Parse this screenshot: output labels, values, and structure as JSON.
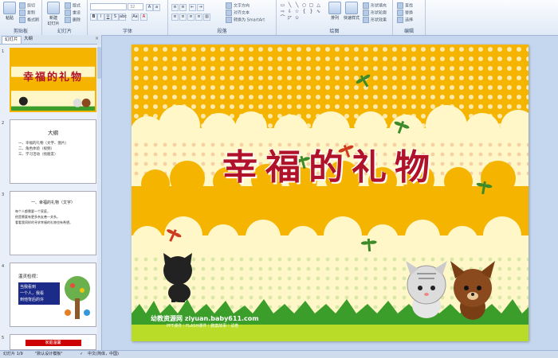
{
  "ribbon": {
    "clipboard": {
      "paste": "粘贴",
      "cut": "剪切",
      "copy": "复制",
      "format_painter": "格式刷",
      "label": "剪贴板"
    },
    "slides": {
      "new_slide": "新建\n幻灯片",
      "layout": "版式",
      "reset": "重设",
      "delete": "删除",
      "label": "幻灯片"
    },
    "font": {
      "size": "32",
      "label": "字体"
    },
    "paragraph": {
      "text_direction": "文字方向",
      "align_text": "对齐文本",
      "smartart": "转换为 SmartArt",
      "label": "段落"
    },
    "drawing": {
      "arrange": "排列",
      "quick_styles": "快速样式",
      "shape_fill": "形状填充",
      "shape_outline": "形状轮廓",
      "shape_effects": "形状效果",
      "label": "绘图"
    },
    "editing": {
      "find": "查找",
      "replace": "替换",
      "select": "选择",
      "label": "编辑"
    }
  },
  "left_pane": {
    "tab_slides": "幻灯片",
    "tab_outline": "大纲",
    "close": "×",
    "thumbs": [
      {
        "num": "1",
        "title": "幸福的礼物"
      },
      {
        "num": "2",
        "title": "大纲",
        "lines": [
          "一、幸福的礼物（文字、图片）",
          "二、角色体验（视频）",
          "三、学习活动（找朋友）"
        ]
      },
      {
        "num": "3",
        "title": "一、幸福的礼物（文字）",
        "lines": [
          "每个人都需要一个家庭，",
          "他是需要有更多亲友善一关系。",
          "看看我同样的寻求幸福的礼物也有希望。"
        ]
      },
      {
        "num": "4",
        "title": "温灵检视：",
        "lines": [
          "当我看到",
          "一个人，我看",
          "到他背后的许"
        ]
      },
      {
        "num": "5",
        "title": "家庭温馨"
      }
    ]
  },
  "slide": {
    "title": "幸福的礼物",
    "watermark_cn": "幼教资源网",
    "watermark_url": "ziyuan.baby611.com",
    "watermark_sub": "PPT课件｜FLASH课件｜教案故事｜试卷"
  },
  "status": {
    "slide_count": "幻灯片 1/9",
    "theme": "\"默认设计模板\"",
    "language": "中文(简体，中国)"
  },
  "colors": {
    "title": "#b0122a",
    "orange_band": "#f4b400",
    "grass": "#3c9e2a"
  }
}
